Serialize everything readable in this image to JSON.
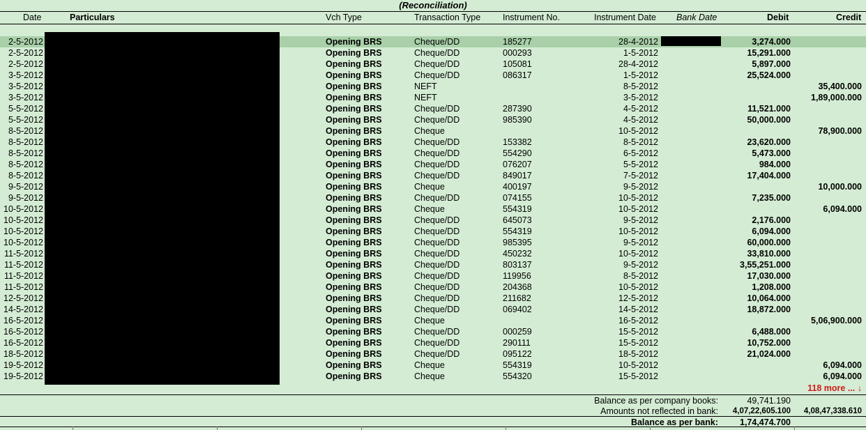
{
  "title": "(Reconciliation)",
  "columns": {
    "date": "Date",
    "particulars": "Particulars",
    "vch_type": "Vch Type",
    "transaction_type": "Transaction Type",
    "instrument_no": "Instrument No.",
    "instrument_date": "Instrument Date",
    "bank_date": "Bank Date",
    "debit": "Debit",
    "credit": "Credit"
  },
  "rows": [
    {
      "date": "2-5-2012",
      "vch": "Opening BRS",
      "ttype": "Cheque/DD",
      "ino": "185277",
      "idate": "28-4-2012",
      "debit": "3,274.000",
      "credit": ""
    },
    {
      "date": "2-5-2012",
      "vch": "Opening BRS",
      "ttype": "Cheque/DD",
      "ino": "000293",
      "idate": "1-5-2012",
      "debit": "15,291.000",
      "credit": ""
    },
    {
      "date": "2-5-2012",
      "vch": "Opening BRS",
      "ttype": "Cheque/DD",
      "ino": "105081",
      "idate": "28-4-2012",
      "debit": "5,897.000",
      "credit": ""
    },
    {
      "date": "3-5-2012",
      "vch": "Opening BRS",
      "ttype": "Cheque/DD",
      "ino": "086317",
      "idate": "1-5-2012",
      "debit": "25,524.000",
      "credit": ""
    },
    {
      "date": "3-5-2012",
      "vch": "Opening BRS",
      "ttype": "NEFT",
      "ino": "",
      "idate": "8-5-2012",
      "debit": "",
      "credit": "35,400.000"
    },
    {
      "date": "3-5-2012",
      "vch": "Opening BRS",
      "ttype": "NEFT",
      "ino": "",
      "idate": "3-5-2012",
      "debit": "",
      "credit": "1,89,000.000"
    },
    {
      "date": "5-5-2012",
      "vch": "Opening BRS",
      "ttype": "Cheque/DD",
      "ino": "287390",
      "idate": "4-5-2012",
      "debit": "11,521.000",
      "credit": ""
    },
    {
      "date": "5-5-2012",
      "vch": "Opening BRS",
      "ttype": "Cheque/DD",
      "ino": "985390",
      "idate": "4-5-2012",
      "debit": "50,000.000",
      "credit": ""
    },
    {
      "date": "8-5-2012",
      "vch": "Opening BRS",
      "ttype": "Cheque",
      "ino": "",
      "idate": "10-5-2012",
      "debit": "",
      "credit": "78,900.000"
    },
    {
      "date": "8-5-2012",
      "vch": "Opening BRS",
      "ttype": "Cheque/DD",
      "ino": "153382",
      "idate": "8-5-2012",
      "debit": "23,620.000",
      "credit": ""
    },
    {
      "date": "8-5-2012",
      "vch": "Opening BRS",
      "ttype": "Cheque/DD",
      "ino": "554290",
      "idate": "6-5-2012",
      "debit": "5,473.000",
      "credit": ""
    },
    {
      "date": "8-5-2012",
      "vch": "Opening BRS",
      "ttype": "Cheque/DD",
      "ino": "076207",
      "idate": "5-5-2012",
      "debit": "984.000",
      "credit": ""
    },
    {
      "date": "8-5-2012",
      "vch": "Opening BRS",
      "ttype": "Cheque/DD",
      "ino": "849017",
      "idate": "7-5-2012",
      "debit": "17,404.000",
      "credit": ""
    },
    {
      "date": "9-5-2012",
      "vch": "Opening BRS",
      "ttype": "Cheque",
      "ino": "400197",
      "idate": "9-5-2012",
      "debit": "",
      "credit": "10,000.000"
    },
    {
      "date": "9-5-2012",
      "vch": "Opening BRS",
      "ttype": "Cheque/DD",
      "ino": "074155",
      "idate": "10-5-2012",
      "debit": "7,235.000",
      "credit": ""
    },
    {
      "date": "10-5-2012",
      "vch": "Opening BRS",
      "ttype": "Cheque",
      "ino": "554319",
      "idate": "10-5-2012",
      "debit": "",
      "credit": "6,094.000"
    },
    {
      "date": "10-5-2012",
      "vch": "Opening BRS",
      "ttype": "Cheque/DD",
      "ino": "645073",
      "idate": "9-5-2012",
      "debit": "2,176.000",
      "credit": ""
    },
    {
      "date": "10-5-2012",
      "vch": "Opening BRS",
      "ttype": "Cheque/DD",
      "ino": "554319",
      "idate": "10-5-2012",
      "debit": "6,094.000",
      "credit": ""
    },
    {
      "date": "10-5-2012",
      "vch": "Opening BRS",
      "ttype": "Cheque/DD",
      "ino": "985395",
      "idate": "9-5-2012",
      "debit": "60,000.000",
      "credit": ""
    },
    {
      "date": "11-5-2012",
      "vch": "Opening BRS",
      "ttype": "Cheque/DD",
      "ino": "450232",
      "idate": "10-5-2012",
      "debit": "33,810.000",
      "credit": ""
    },
    {
      "date": "11-5-2012",
      "vch": "Opening BRS",
      "ttype": "Cheque/DD",
      "ino": "803137",
      "idate": "9-5-2012",
      "debit": "3,55,251.000",
      "credit": ""
    },
    {
      "date": "11-5-2012",
      "vch": "Opening BRS",
      "ttype": "Cheque/DD",
      "ino": "119956",
      "idate": "8-5-2012",
      "debit": "17,030.000",
      "credit": ""
    },
    {
      "date": "11-5-2012",
      "vch": "Opening BRS",
      "ttype": "Cheque/DD",
      "ino": "204368",
      "idate": "10-5-2012",
      "debit": "1,208.000",
      "credit": ""
    },
    {
      "date": "12-5-2012",
      "vch": "Opening BRS",
      "ttype": "Cheque/DD",
      "ino": "211682",
      "idate": "12-5-2012",
      "debit": "10,064.000",
      "credit": ""
    },
    {
      "date": "14-5-2012",
      "vch": "Opening BRS",
      "ttype": "Cheque/DD",
      "ino": "069402",
      "idate": "14-5-2012",
      "debit": "18,872.000",
      "credit": ""
    },
    {
      "date": "16-5-2012",
      "vch": "Opening BRS",
      "ttype": "Cheque",
      "ino": "",
      "idate": "16-5-2012",
      "debit": "",
      "credit": "5,06,900.000"
    },
    {
      "date": "16-5-2012",
      "vch": "Opening BRS",
      "ttype": "Cheque/DD",
      "ino": "000259",
      "idate": "15-5-2012",
      "debit": "6,488.000",
      "credit": ""
    },
    {
      "date": "16-5-2012",
      "vch": "Opening BRS",
      "ttype": "Cheque/DD",
      "ino": "290111",
      "idate": "15-5-2012",
      "debit": "10,752.000",
      "credit": ""
    },
    {
      "date": "18-5-2012",
      "vch": "Opening BRS",
      "ttype": "Cheque/DD",
      "ino": "095122",
      "idate": "18-5-2012",
      "debit": "21,024.000",
      "credit": ""
    },
    {
      "date": "19-5-2012",
      "vch": "Opening BRS",
      "ttype": "Cheque",
      "ino": "554319",
      "idate": "10-5-2012",
      "debit": "",
      "credit": "6,094.000"
    },
    {
      "date": "19-5-2012",
      "vch": "Opening BRS",
      "ttype": "Cheque",
      "ino": "554320",
      "idate": "15-5-2012",
      "debit": "",
      "credit": "6,094.000"
    }
  ],
  "more_indicator": "118 more ... ↓",
  "summary": {
    "company_books_label": "Balance as per company books:",
    "company_books_value": "49,741.190",
    "not_reflected_label": "Amounts not reflected in bank:",
    "not_reflected_debit": "4,07,22,605.100",
    "not_reflected_credit": "4,08,47,338.610",
    "bank_balance_label": "Balance as per bank:",
    "bank_balance_value": "1,74,474.700"
  },
  "colors": {
    "background": "#d4ecd4",
    "selected_row": "#a9d0a9",
    "more_text": "#d21a1a"
  }
}
